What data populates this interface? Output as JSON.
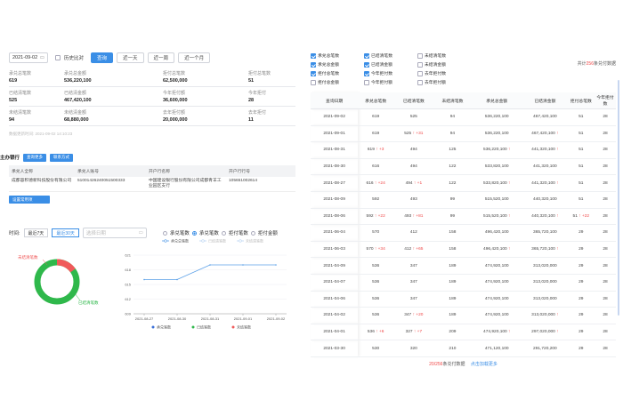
{
  "filters": {
    "date": "2021-09-02",
    "history_compare_label": "历史比对",
    "query_label": "查询",
    "recent_day": "近一天",
    "recent_week": "近一周",
    "recent_month": "近一个月"
  },
  "stats": [
    {
      "label": "承兑总笔数",
      "value": "619"
    },
    {
      "label": "承兑总金额",
      "value": "536,220,100"
    },
    {
      "label": "拒付总笔数",
      "value": "62,500,000"
    },
    {
      "label": "拒付总笔数",
      "value": "51"
    },
    {
      "label": "已结清笔数",
      "value": "525"
    },
    {
      "label": "已结清金额",
      "value": "467,420,100"
    },
    {
      "label": "今年拒付额",
      "value": "36,600,000"
    },
    {
      "label": "今年拒付",
      "value": "28"
    },
    {
      "label": "未结清笔数",
      "value": "94"
    },
    {
      "label": "未结清金额",
      "value": "68,880,000"
    },
    {
      "label": "去年拒付额",
      "value": "20,000,000"
    },
    {
      "label": "去年拒付",
      "value": "11"
    }
  ],
  "update_time": "数据更新时间: 2021-09-02 14:10:23",
  "payer": {
    "title": "主办银行",
    "query_more": "查询更多",
    "contact": "联系方式",
    "headers": [
      "承兑人全称",
      "承兑人账号",
      "开户行名称",
      "开户行行号"
    ],
    "row": [
      "成都容积德新科技股份有限公司",
      "51001426240051500333",
      "中国建设银行股份有限公司成都青羊工业园区支行",
      "105651002614"
    ],
    "set_common": "设置常用项"
  },
  "time_filter": {
    "label": "时间:",
    "last7": "最近7天",
    "last30": "最近30天",
    "range_placeholder": "选择日期",
    "radio_labels": [
      "承兑笔数",
      "承兑笔数",
      "拒付笔数",
      "拒付金额"
    ]
  },
  "donut": {
    "label_unsettled": "未结清笔数",
    "label_settled": "已结清笔数",
    "settled": 525,
    "unsettled": 94,
    "colors": {
      "settled": "#2fb84b",
      "unsettled": "#f05a5a"
    }
  },
  "chart_data": {
    "type": "line",
    "legend": [
      "承兑总笔数",
      "已结清笔数",
      "未结清笔数"
    ],
    "x": [
      "2021-08-27",
      "2021-08-30",
      "2021-08-31",
      "2021-09-01",
      "2021-09-02"
    ],
    "series": [
      {
        "name": "承兑总笔数",
        "values": [
          616,
          616,
          619,
          619,
          619
        ]
      }
    ],
    "yticks": [
      609,
      612,
      615,
      618,
      621
    ],
    "ylim": [
      609,
      621
    ],
    "bottom_legend": [
      "承兑笔数",
      "已结笔数",
      "未结笔数"
    ],
    "colors": {
      "line": "#5ba0e8"
    }
  },
  "right": {
    "checkboxes": [
      {
        "label": "承兑总笔数",
        "on": true
      },
      {
        "label": "已结清笔数",
        "on": true
      },
      {
        "label": "未结清笔数",
        "on": false
      },
      {
        "label": "承兑总金额",
        "on": true
      },
      {
        "label": "已结清金额",
        "on": true
      },
      {
        "label": "未结清金额",
        "on": false
      },
      {
        "label": "拒付总笔数",
        "on": true
      },
      {
        "label": "今年拒付数",
        "on": true
      },
      {
        "label": "去年拒付数",
        "on": false
      },
      {
        "label": "拒付总金额",
        "on": false
      },
      {
        "label": "今年拒付额",
        "on": false
      },
      {
        "label": "去年拒付额",
        "on": false
      }
    ],
    "total_prefix": "共计",
    "total_count": "256",
    "total_suffix": "条兑付数据",
    "headers": [
      "查询日期",
      "承兑总笔数",
      "已结清笔数",
      "未结清笔数",
      "承兑总金额",
      "已结清金额",
      "拒付总笔数",
      "今年拒付数"
    ],
    "rows": [
      [
        "2021-09-02",
        "619",
        "525",
        "94",
        "536,220,100",
        "467,420,100",
        "51",
        "28"
      ],
      [
        "2021-09-01",
        "619",
        "525 ↑ +31",
        "94",
        "536,220,100",
        "467,420,100 ↑",
        "51",
        "28"
      ],
      [
        "2021-08-31",
        "619 ↑ +3",
        "494",
        "125",
        "536,220,100 ↑",
        "441,320,100 ↑",
        "51",
        "28"
      ],
      [
        "2021-08-30",
        "616",
        "494",
        "122",
        "533,820,100",
        "441,320,100",
        "51",
        "28"
      ],
      [
        "2021-08-27",
        "616 ↑ +24",
        "494 ↑ +1",
        "122",
        "533,820,100 ↑",
        "441,320,100 ↑",
        "51",
        "28"
      ],
      [
        "2021-08-09",
        "592",
        "493",
        "99",
        "515,520,100",
        "440,320,100",
        "51",
        "28"
      ],
      [
        "2021-08-06",
        "592 ↑ +22",
        "493 ↑ +81",
        "99",
        "515,520,100 ↑",
        "440,320,100 ↑",
        "51 ↑ +22",
        "28"
      ],
      [
        "2021-06-04",
        "570",
        "412",
        "158",
        "496,420,100",
        "365,720,100",
        "29",
        "28"
      ],
      [
        "2021-06-03",
        "570 ↑ +34",
        "412 ↑ +65",
        "158",
        "496,420,100 ↑",
        "365,720,100 ↑",
        "29",
        "28"
      ],
      [
        "2021-04-09",
        "536",
        "347",
        "189",
        "474,920,100",
        "313,020,000",
        "29",
        "28"
      ],
      [
        "2021-04-07",
        "536",
        "347",
        "189",
        "474,920,100",
        "313,020,000",
        "29",
        "28"
      ],
      [
        "2021-04-06",
        "536",
        "347",
        "189",
        "474,920,100",
        "313,020,000",
        "29",
        "28"
      ],
      [
        "2021-04-02",
        "536",
        "347 ↑ +20",
        "189",
        "474,920,100",
        "313,020,000 ↑",
        "29",
        "28"
      ],
      [
        "2021-04-01",
        "536 ↑ +6",
        "327 ↑ +7",
        "209",
        "474,920,100 ↑",
        "297,020,000 ↑",
        "29",
        "28"
      ],
      [
        "2021-03-30",
        "530",
        "320",
        "210",
        "471,120,100",
        "291,720,200",
        "29",
        "28"
      ]
    ],
    "footer_shown": "20/256",
    "footer_text": "条兑付数据",
    "load_more": "点击加载更多"
  }
}
